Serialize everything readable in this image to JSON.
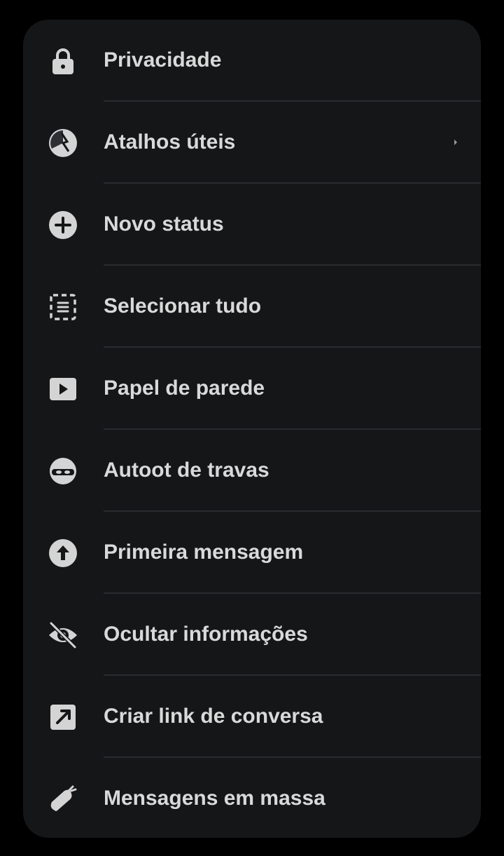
{
  "colors": {
    "background": "#000000",
    "panel": "#151618",
    "text": "#d9d9d9",
    "icon": "#d4d4d4",
    "divider": "#2a2b2e"
  },
  "menu": {
    "items": [
      {
        "label": "Privacidade",
        "icon": "lock-icon"
      },
      {
        "label": "Atalhos úteis",
        "icon": "shortcuts-icon",
        "has_submenu": true
      },
      {
        "label": "Novo status",
        "icon": "add-circle-icon"
      },
      {
        "label": "Selecionar tudo",
        "icon": "select-all-icon"
      },
      {
        "label": "Papel de parede",
        "icon": "play-icon"
      },
      {
        "label": "Autoot de travas",
        "icon": "ninja-icon"
      },
      {
        "label": "Primeira mensagem",
        "icon": "arrow-up-circle-icon"
      },
      {
        "label": "Ocultar informações",
        "icon": "eye-off-icon"
      },
      {
        "label": "Criar link de conversa",
        "icon": "external-link-icon"
      },
      {
        "label": "Mensagens em massa",
        "icon": "bomb-icon"
      }
    ]
  }
}
